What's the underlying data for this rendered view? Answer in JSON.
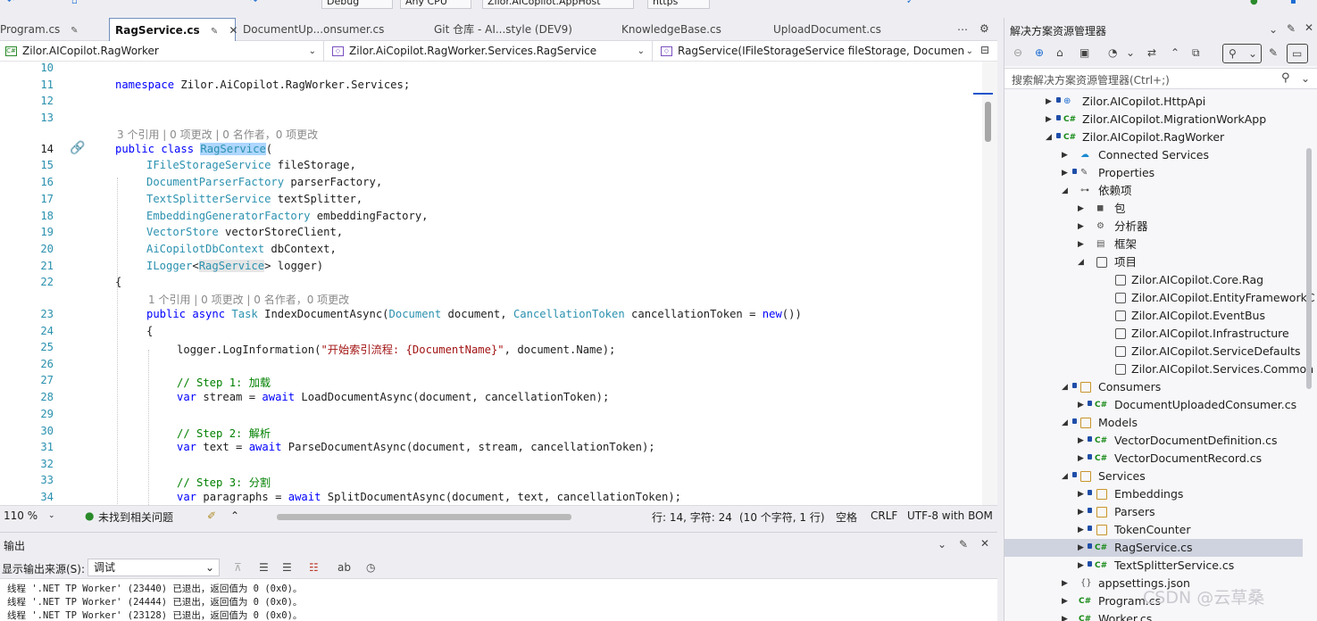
{
  "toolbar": {
    "config": "Debug",
    "platform": "Any CPU",
    "startup": "Zilor.AiCopilot.AppHost",
    "launch": "https"
  },
  "editor": {
    "tabs": [
      {
        "label": "Program.cs"
      },
      {
        "label": "RagService.cs",
        "active": true
      },
      {
        "label": "DocumentUp...onsumer.cs"
      },
      {
        "label": "Git 仓库 - AI...style (DEV9)"
      },
      {
        "label": "KnowledgeBase.cs"
      },
      {
        "label": "UploadDocument.cs"
      }
    ],
    "nav": {
      "project": "Zilor.AICopilot.RagWorker",
      "type": "Zilor.AiCopilot.RagWorker.Services.RagService",
      "member": "RagService(IFileStorageService fileStorage, Documen"
    },
    "lines": {
      "n10": "10",
      "n11": "11",
      "n12": "12",
      "n13": "13",
      "n14": "14",
      "n15": "15",
      "n16": "16",
      "n17": "17",
      "n18": "18",
      "n19": "19",
      "n20": "20",
      "n21": "21",
      "n22": "22",
      "n23": "23",
      "n24": "24",
      "n25": "25",
      "n26": "26",
      "n27": "27",
      "n28": "28",
      "n29": "29",
      "n30": "30",
      "n31": "31",
      "n32": "32",
      "n33": "33",
      "n34": "34"
    },
    "code": {
      "l11_kw": "namespace",
      "l11_rest": " Zilor.AiCopilot.RagWorker.Services;",
      "lens_class": "3 个引用 | 0 项更改 | 0 名作者，0 项更改",
      "l14_kw": "public class",
      "l14_name": "RagService",
      "l14_paren": "(",
      "p1_type": "IFileStorageService",
      "p1_name": " fileStorage,",
      "p2_type": "DocumentParserFactory",
      "p2_name": " parserFactory,",
      "p3_type": "TextSplitterService",
      "p3_name": " textSplitter,",
      "p4_type": "EmbeddingGeneratorFactory",
      "p4_name": " embeddingFactory,",
      "p5_type": "VectorStore",
      "p5_name": " vectorStoreClient,",
      "p6_type": "AiCopilotDbContext",
      "p6_name": " dbContext,",
      "p7_type": "ILogger",
      "p7_lt": "<",
      "p7_gen": "RagService",
      "p7_name": "> logger)",
      "l22": "{",
      "lens_method": "1 个引用 | 0 项更改 | 0 名作者，0 项更改",
      "l23_kw1": "public async",
      "l23_ty1": "Task",
      "l23_m": " IndexDocumentAsync(",
      "l23_ty2": "Document",
      "l23_a": " document, ",
      "l23_ty3": "CancellationToken",
      "l23_b": " cancellationToken = ",
      "l23_kw2": "new",
      "l23_c": "())",
      "l24": "{",
      "l25_a": "logger.LogInformation(",
      "l25_str": "\"开始索引流程: {DocumentName}\"",
      "l25_b": ", document.Name);",
      "l27_cm": "// Step 1: 加载",
      "l28_kw": "var",
      "l28_a": " stream = ",
      "l28_kw2": "await",
      "l28_b": " LoadDocumentAsync(document, cancellationToken);",
      "l30_cm": "// Step 2: 解析",
      "l31_kw": "var",
      "l31_a": " text = ",
      "l31_kw2": "await",
      "l31_b": " ParseDocumentAsync(document, stream, cancellationToken);",
      "l33_cm": "// Step 3: 分割",
      "l34_kw": "var",
      "l34_a": " paragraphs = ",
      "l34_kw2": "await",
      "l34_b": " SplitDocumentAsync(document, text, cancellationToken);"
    },
    "status": {
      "zoom": "110 %",
      "issues": "未找到相关问题",
      "position": "行: 14, 字符: 24",
      "selection": "(10 个字符, 1 行)",
      "whitespace": "空格",
      "eol": "CRLF",
      "encoding": "UTF-8 with BOM"
    }
  },
  "output": {
    "title": "输出",
    "source_label": "显示输出来源(S):",
    "source_value": "调试",
    "lines": [
      "线程 '.NET TP Worker' (23440) 已退出，返回值为 0 (0x0)。",
      "线程 '.NET TP Worker' (24444) 已退出，返回值为 0 (0x0)。",
      "线程 '.NET TP Worker' (23128) 已退出，返回值为 0 (0x0)。"
    ]
  },
  "solution_explorer": {
    "title": "解决方案资源管理器",
    "search_placeholder": "搜索解决方案资源管理器(Ctrl+;)",
    "items": [
      {
        "label": "Zilor.AICopilot.HttpApi"
      },
      {
        "label": "Zilor.AICopilot.MigrationWorkApp"
      },
      {
        "label": "Zilor.AICopilot.RagWorker"
      },
      {
        "label": "Connected Services"
      },
      {
        "label": "Properties"
      },
      {
        "label": "依赖项"
      },
      {
        "label": "包"
      },
      {
        "label": "分析器"
      },
      {
        "label": "框架"
      },
      {
        "label": "项目"
      },
      {
        "label": "Zilor.AICopilot.Core.Rag"
      },
      {
        "label": "Zilor.AICopilot.EntityFrameworkC"
      },
      {
        "label": "Zilor.AICopilot.EventBus"
      },
      {
        "label": "Zilor.AICopilot.Infrastructure"
      },
      {
        "label": "Zilor.AICopilot.ServiceDefaults"
      },
      {
        "label": "Zilor.AICopilot.Services.Common"
      },
      {
        "label": "Consumers"
      },
      {
        "label": "DocumentUploadedConsumer.cs"
      },
      {
        "label": "Models"
      },
      {
        "label": "VectorDocumentDefinition.cs"
      },
      {
        "label": "VectorDocumentRecord.cs"
      },
      {
        "label": "Services"
      },
      {
        "label": "Embeddings"
      },
      {
        "label": "Parsers"
      },
      {
        "label": "TokenCounter"
      },
      {
        "label": "RagService.cs"
      },
      {
        "label": "TextSplitterService.cs"
      },
      {
        "label": "appsettings.json"
      },
      {
        "label": "Program.cs"
      },
      {
        "label": "Worker.cs"
      }
    ]
  },
  "watermark": "CSDN @云草桑"
}
